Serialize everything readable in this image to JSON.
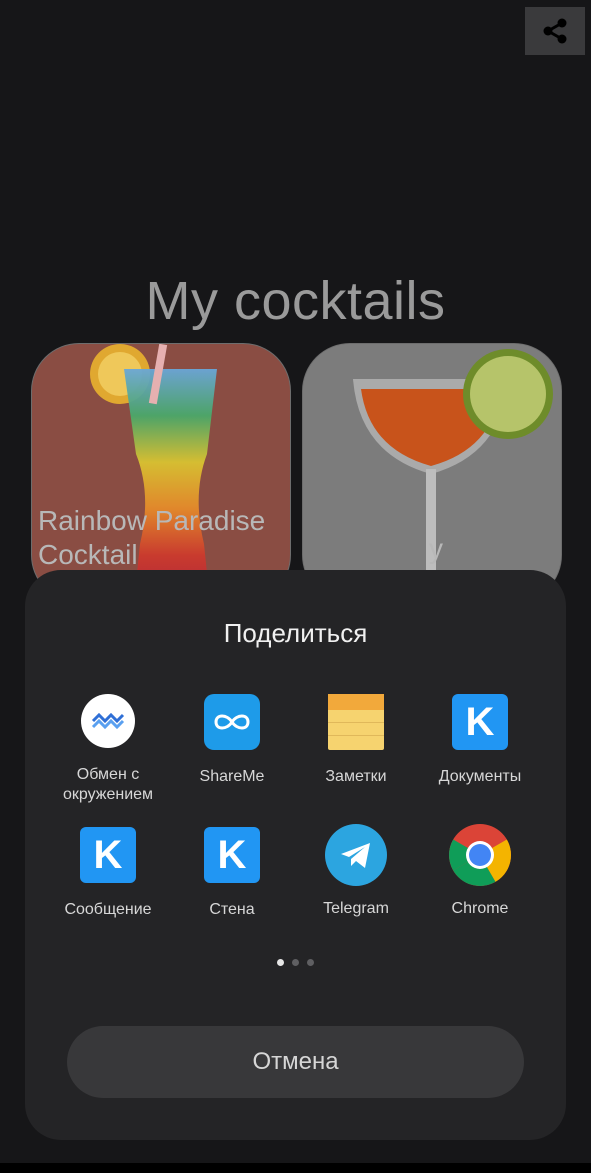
{
  "page": {
    "title": "My cocktails"
  },
  "cards": [
    {
      "name": "Rainbow Paradise Cocktail",
      "line1": "Rainbow Paradise",
      "line2": "Cocktail"
    },
    {
      "name": "y"
    }
  ],
  "share_sheet": {
    "title": "Поделиться",
    "apps": [
      {
        "label": "Обмен с окружением",
        "line1": "Обмен с",
        "line2": "окружением",
        "icon": "nearby-share-icon"
      },
      {
        "label": "ShareMe",
        "icon": "shareme-icon"
      },
      {
        "label": "Заметки",
        "icon": "notes-icon"
      },
      {
        "label": "Документы",
        "icon": "vk-icon"
      },
      {
        "label": "Сообщение",
        "icon": "vk-icon"
      },
      {
        "label": "Стена",
        "icon": "vk-icon"
      },
      {
        "label": "Telegram",
        "icon": "telegram-icon"
      },
      {
        "label": "Chrome",
        "icon": "chrome-icon"
      }
    ],
    "pages": 3,
    "current_page": 1,
    "cancel_label": "Отмена"
  },
  "colors": {
    "background": "#161618",
    "sheet": "#242426",
    "shareme_blue": "#1e9be9",
    "vk_blue": "#2196f3",
    "telegram_blue": "#2ca5e0",
    "notes_yellow": "#f6d36f"
  }
}
